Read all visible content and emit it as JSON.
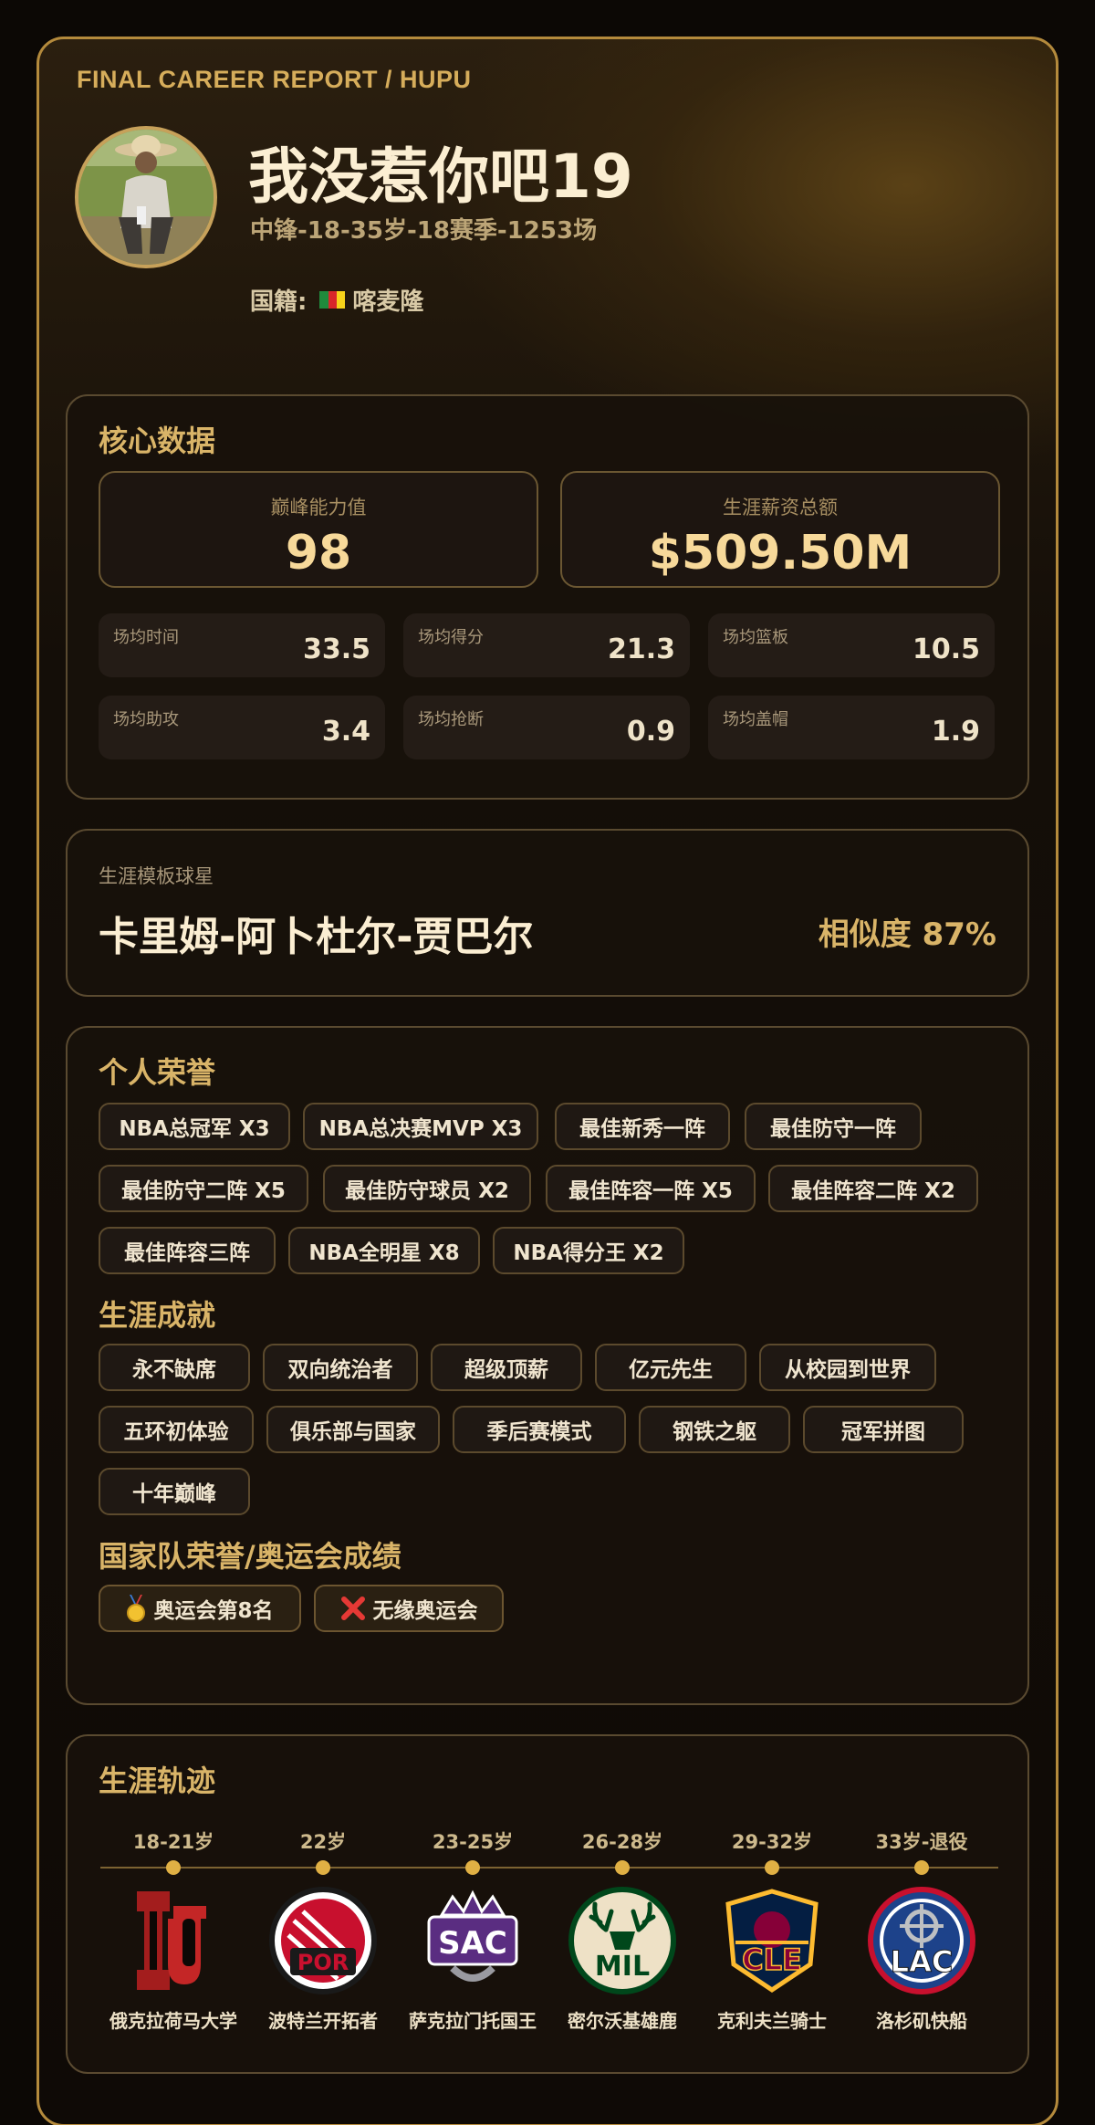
{
  "header": {
    "report_title": "FINAL CAREER REPORT / HUPU",
    "player_name": "我没惹你吧19",
    "player_sub": "中锋-18-35岁-18赛季-1253场",
    "nationality_label": "国籍:",
    "nationality": "喀麦隆"
  },
  "core": {
    "title": "核心数据",
    "peak_label": "巅峰能力值",
    "peak_value": "98",
    "salary_label": "生涯薪资总额",
    "salary_value": "$509.50M",
    "stats": [
      {
        "label": "场均时间",
        "value": "33.5"
      },
      {
        "label": "场均得分",
        "value": "21.3"
      },
      {
        "label": "场均篮板",
        "value": "10.5"
      },
      {
        "label": "场均助攻",
        "value": "3.4"
      },
      {
        "label": "场均抢断",
        "value": "0.9"
      },
      {
        "label": "场均盖帽",
        "value": "1.9"
      }
    ]
  },
  "template": {
    "label": "生涯模板球星",
    "player": "卡里姆-阿卜杜尔-贾巴尔",
    "similarity": "相似度 87%"
  },
  "honors": {
    "title": "个人荣誉",
    "items": [
      "NBA总冠军 X3",
      "NBA总决赛MVP X3",
      "最佳新秀一阵",
      "最佳防守一阵",
      "最佳防守二阵 X5",
      "最佳防守球员 X2",
      "最佳阵容一阵 X5",
      "最佳阵容二阵 X2",
      "最佳阵容三阵",
      "NBA全明星 X8",
      "NBA得分王 X2"
    ]
  },
  "achievements": {
    "title": "生涯成就",
    "items": [
      "永不缺席",
      "双向统治者",
      "超级顶薪",
      "亿元先生",
      "从校园到世界",
      "五环初体验",
      "俱乐部与国家",
      "季后赛模式",
      "钢铁之躯",
      "冠军拼图",
      "十年巅峰"
    ]
  },
  "national": {
    "title": "国家队荣誉/奥运会成绩",
    "items": [
      {
        "icon": "medal-icon",
        "label": "奥运会第8名"
      },
      {
        "icon": "cross-icon",
        "label": "无缘奥运会"
      }
    ]
  },
  "career": {
    "title": "生涯轨迹",
    "stops": [
      {
        "age": "18-21岁",
        "logo": "OU",
        "team": "俄克拉荷马大学"
      },
      {
        "age": "22岁",
        "logo": "POR",
        "team": "波特兰开拓者"
      },
      {
        "age": "23-25岁",
        "logo": "SAC",
        "team": "萨克拉门托国王"
      },
      {
        "age": "26-28岁",
        "logo": "MIL",
        "team": "密尔沃基雄鹿"
      },
      {
        "age": "29-32岁",
        "logo": "CLE",
        "team": "克利夫兰骑士"
      },
      {
        "age": "33岁-退役",
        "logo": "LAC",
        "team": "洛杉矶快船"
      }
    ]
  },
  "colors": {
    "accent": "#d9b468",
    "border": "#b48a3c",
    "dot": "#e0b044"
  }
}
